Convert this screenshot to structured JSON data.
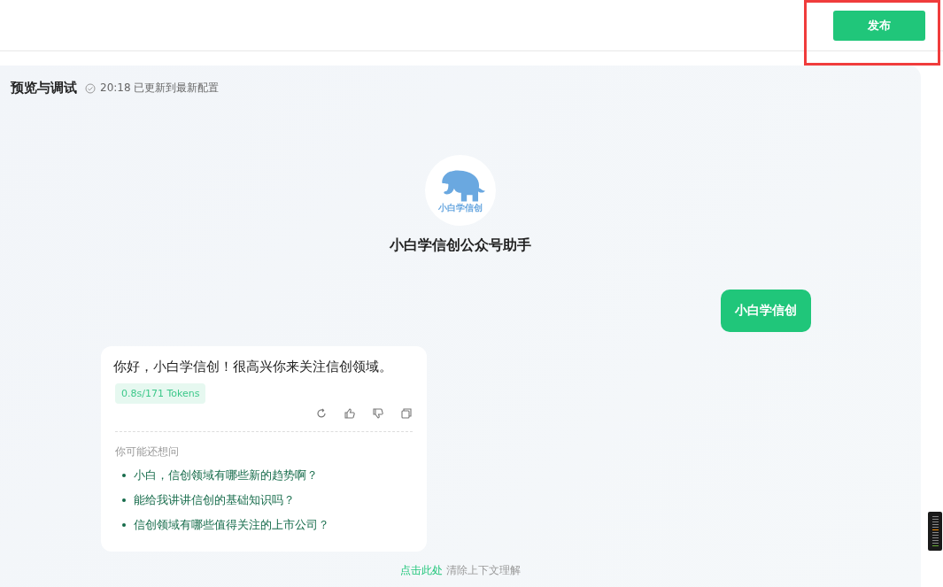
{
  "header": {
    "publish_button": "发布",
    "highlight": {
      "kind": "rectangle"
    }
  },
  "preview": {
    "title": "预览与调试",
    "status_time": "20:18",
    "status_text": "已更新到最新配置",
    "bot": {
      "avatar_caption": "小白学信创",
      "name": "小白学信创公众号助手"
    },
    "messages": [
      {
        "kind": "user",
        "text": "小白学信创"
      },
      {
        "kind": "bot",
        "text": "你好，小白学信创！很高兴你来关注信创领域。",
        "stats": "0.8s/171 Tokens",
        "suggestions_title": "你可能还想问",
        "suggestions": [
          "小白，信创领域有哪些新的趋势啊？",
          "能给我讲讲信创的基础知识吗？",
          "信创领域有哪些值得关注的上市公司？"
        ]
      }
    ],
    "clear_context": {
      "link": "点击此处",
      "text": "清除上下文理解"
    }
  }
}
